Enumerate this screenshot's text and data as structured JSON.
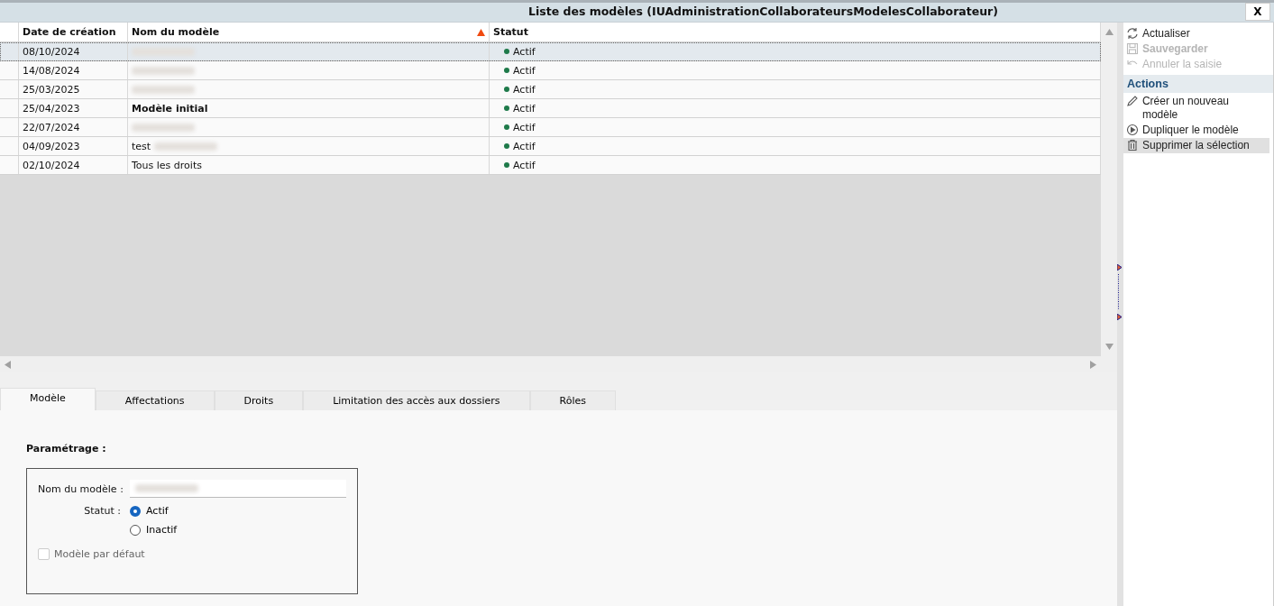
{
  "window": {
    "title": "Liste des modèles (IUAdministrationCollaborateursModelesCollaborateur)",
    "close": "X"
  },
  "table": {
    "columns": [
      {
        "label": "Date de création",
        "sorted": false
      },
      {
        "label": "Nom du modèle",
        "sorted": true
      },
      {
        "label": "Statut",
        "sorted": false
      }
    ],
    "rows": [
      {
        "date": "08/10/2024",
        "name": "",
        "redacted": true,
        "bold": false,
        "status": "Actif",
        "color": "#1e7a4a",
        "selected": true
      },
      {
        "date": "14/08/2024",
        "name": "",
        "redacted": true,
        "bold": false,
        "status": "Actif",
        "color": "#1e7a4a",
        "selected": false
      },
      {
        "date": "25/03/2025",
        "name": "",
        "redacted": true,
        "bold": false,
        "status": "Actif",
        "color": "#1e7a4a",
        "selected": false
      },
      {
        "date": "25/04/2023",
        "name": "Modèle initial",
        "redacted": false,
        "bold": true,
        "status": "Actif",
        "color": "#1e7a4a",
        "selected": false
      },
      {
        "date": "22/07/2024",
        "name": "",
        "redacted": true,
        "bold": false,
        "status": "Actif",
        "color": "#1e7a4a",
        "selected": false
      },
      {
        "date": "04/09/2023",
        "name": "test",
        "redacted": true,
        "bold": false,
        "status": "Actif",
        "color": "#1e7a4a",
        "selected": false
      },
      {
        "date": "02/10/2024",
        "name": "Tous les droits",
        "redacted": false,
        "bold": false,
        "status": "Actif",
        "color": "#1e7a4a",
        "selected": false
      }
    ]
  },
  "tabs": [
    {
      "label": "Modèle",
      "selected": true
    },
    {
      "label": "Affectations",
      "selected": false
    },
    {
      "label": "Droits",
      "selected": false
    },
    {
      "label": "Limitation des accès aux dossiers",
      "selected": false
    },
    {
      "label": "Rôles",
      "selected": false
    }
  ],
  "form": {
    "section": "Paramétrage :",
    "name_label": "Nom du modèle :",
    "name_redacted": true,
    "status_label": "Statut :",
    "status_options": [
      {
        "label": "Actif",
        "selected": true
      },
      {
        "label": "Inactif",
        "selected": false
      }
    ],
    "default_checkbox": {
      "label": "Modèle par défaut",
      "checked": false,
      "disabled": true
    }
  },
  "sidebar": {
    "top_items": [
      {
        "kind": "refresh",
        "label": "Actualiser",
        "disabled": false,
        "bold": false
      },
      {
        "kind": "save",
        "label": "Sauvegarder",
        "disabled": true,
        "bold": true
      },
      {
        "kind": "undo",
        "label": "Annuler la saisie",
        "disabled": true,
        "bold": false
      }
    ],
    "actions_title": "Actions",
    "actions": [
      {
        "kind": "pencil",
        "label": "Créer un nouveau modèle",
        "highlighted": false
      },
      {
        "kind": "play",
        "label": "Dupliquer le modèle",
        "highlighted": false
      },
      {
        "kind": "trash",
        "label": "Supprimer la sélection",
        "highlighted": true
      }
    ]
  }
}
